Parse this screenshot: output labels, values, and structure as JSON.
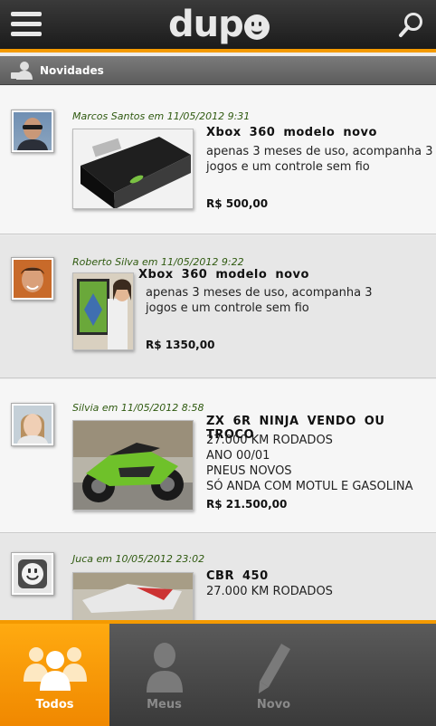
{
  "header": {
    "logo_text": "dup",
    "menu_icon": "hamburger-menu-icon",
    "search_icon": "magnifier-icon"
  },
  "section": {
    "title": "Novidades",
    "icon": "user-news-icon"
  },
  "posts": [
    {
      "meta": "Marcos Santos em 11/05/2012 9:31",
      "title": "Xbox  360  modelo  novo",
      "description": [
        "apenas 3 meses de uso, acompanha 3",
        "jogos e um controle sem fio"
      ],
      "price": "R$ 500,00"
    },
    {
      "meta": "Roberto Silva em 11/05/2012 9:22",
      "title": "Xbox  360  modelo  novo",
      "description": [
        "apenas 3 meses de uso, acompanha 3",
        "jogos e um controle sem fio"
      ],
      "price": "R$ 1350,00"
    },
    {
      "meta": "Silvia em 11/05/2012 8:58",
      "title": "ZX  6R  NINJA  VENDO  OU  TROCO",
      "description": [
        "27.000 KM RODADOS",
        "ANO 00/01",
        "PNEUS NOVOS",
        "SÓ ANDA COM MOTUL E GASOLINA"
      ],
      "price": "R$ 21.500,00"
    },
    {
      "meta": "Juca em 10/05/2012 23:02",
      "title": "CBR  450",
      "description": [
        "27.000 KM RODADOS"
      ],
      "price": ""
    }
  ],
  "tabs": [
    {
      "label": "Todos",
      "icon": "group-users-icon",
      "active": true
    },
    {
      "label": "Meus",
      "icon": "single-user-icon",
      "active": false
    },
    {
      "label": "Novo",
      "icon": "pencil-icon",
      "active": false
    }
  ],
  "colors": {
    "accent": "#f49a00",
    "topbar": "#2a2a2a",
    "meta_text": "#2f5a10"
  }
}
